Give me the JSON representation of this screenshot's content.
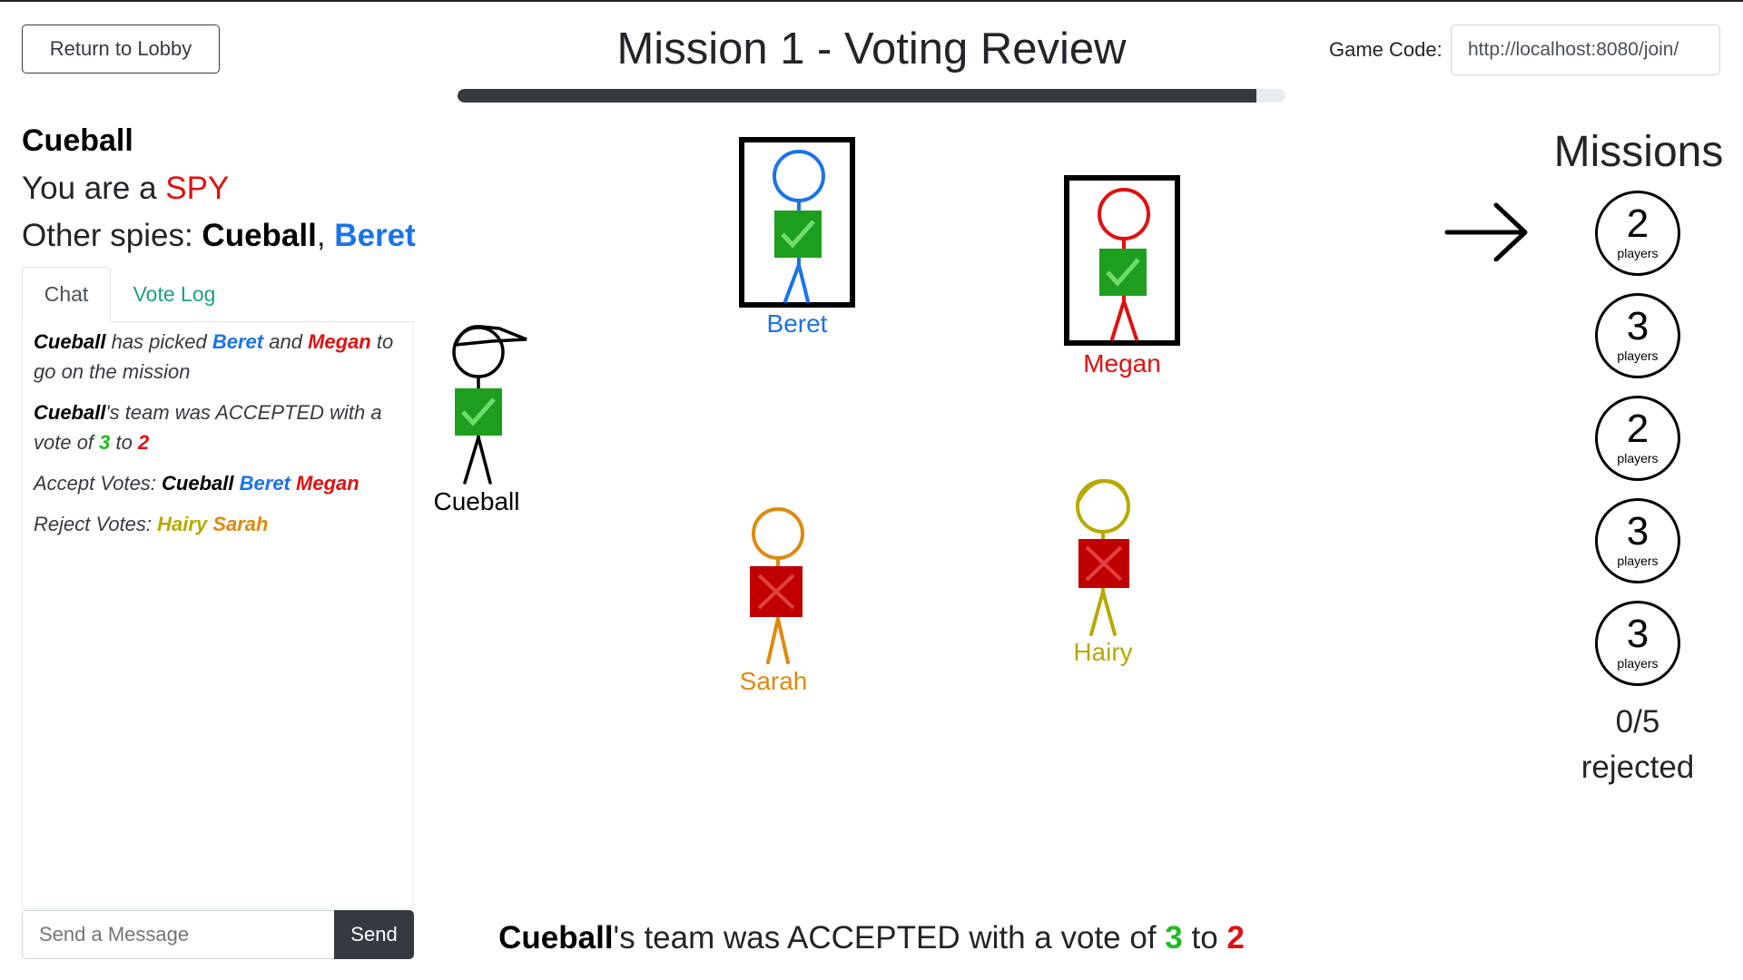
{
  "header": {
    "lobby_button": "Return to Lobby",
    "title": "Mission 1 - Voting Review",
    "progress": 0.965,
    "game_code_label": "Game Code:",
    "game_code_value": "http://localhost:8080/join/"
  },
  "me": {
    "name": "Cueball",
    "role_prefix": "You are a ",
    "role": "SPY",
    "spies_prefix": "Other spies: ",
    "spies": [
      "Cueball",
      "Beret"
    ],
    "spies_sep": ", "
  },
  "tabs": [
    {
      "label": "Chat",
      "active": true
    },
    {
      "label": "Vote Log",
      "active": false
    }
  ],
  "chat": {
    "msg1": {
      "leader": "Cueball",
      "t1": " has picked ",
      "p1": "Beret",
      "t2": " and ",
      "p2": "Megan",
      "t3": " to go on the mission"
    },
    "msg2": {
      "leader": "Cueball",
      "t1": "'s team was ACCEPTED with a vote of ",
      "yes": "3",
      "t2": " to ",
      "no": "2"
    },
    "msg3": {
      "label": "Accept Votes: ",
      "names": [
        "Cueball",
        "Beret",
        "Megan"
      ]
    },
    "msg4": {
      "label": "Reject Votes: ",
      "names": [
        "Hairy",
        "Sarah"
      ]
    },
    "input_placeholder": "Send a Message",
    "send_label": "Send"
  },
  "players": {
    "cueball": {
      "name": "Cueball",
      "color": "#000000",
      "vote": "accept",
      "on_team": false
    },
    "beret": {
      "name": "Beret",
      "color": "#1a73e8",
      "vote": "accept",
      "on_team": true
    },
    "megan": {
      "name": "Megan",
      "color": "#e01010",
      "vote": "accept",
      "on_team": true
    },
    "sarah": {
      "name": "Sarah",
      "color": "#dd8a10",
      "vote": "reject",
      "on_team": false
    },
    "hairy": {
      "name": "Hairy",
      "color": "#b8a800",
      "vote": "reject",
      "on_team": false
    }
  },
  "summary": {
    "leader": "Cueball",
    "t1": "'s team was ACCEPTED with a vote of ",
    "yes": "3",
    "t2": " to ",
    "no": "2"
  },
  "missions": {
    "title": "Missions",
    "list": [
      {
        "num": "2",
        "label": "players",
        "current": true
      },
      {
        "num": "3",
        "label": "players"
      },
      {
        "num": "2",
        "label": "players"
      },
      {
        "num": "3",
        "label": "players"
      },
      {
        "num": "3",
        "label": "players"
      }
    ],
    "rejected_count": "0/5",
    "rejected_label": "rejected"
  },
  "colors": {
    "dark": "#343a40",
    "accept_green": "#1e9e1e",
    "reject_red": "#c00000",
    "link_teal": "#20a080"
  }
}
